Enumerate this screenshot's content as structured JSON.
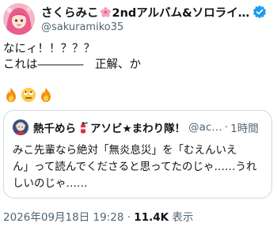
{
  "author": {
    "display_name_part1": "さくらみこ",
    "display_name_part2": "2ndアルバム&ソロライ…",
    "handle": "@sakuramiko35"
  },
  "tweet": {
    "line1": "なにィ！！？？？",
    "line2": "これは――――　正解、か",
    "emoji_names": [
      "fire-icon",
      "eye-roll-face-icon",
      "fire-icon"
    ]
  },
  "quote": {
    "name_part1": "熱千めら",
    "name_part2": "アソビ★まわり隊！",
    "handle": "@ac…",
    "separator": "·",
    "time": "1時間",
    "line1": "みこ先輩なら絶対「無炎息災」を「むえんいえ",
    "line2": "ん」って読んでくださると思ってたのじゃ……うれ",
    "line3": "しいのじゃ……"
  },
  "meta": {
    "timestamp": "2026年09月18日 19:28",
    "dot": " · ",
    "views_count": "11.4K",
    "views_label": " 表示"
  },
  "colors": {
    "text": "#0f1419",
    "secondary": "#536471",
    "border": "#cfd9de",
    "verified": "#1d9bf0"
  }
}
